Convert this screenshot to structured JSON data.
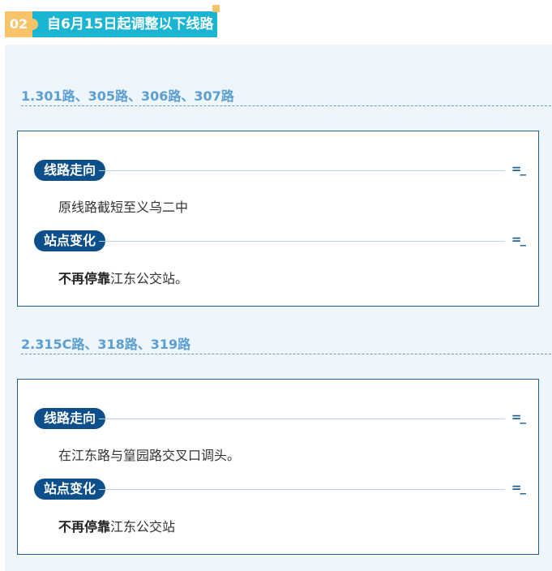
{
  "header": {
    "number": "02",
    "title": "自6月15日起调整以下线路"
  },
  "sections": [
    {
      "title": "1.301路、305路、306路、307路",
      "route_label": "线路走向",
      "route_text": "原线路截短至义乌二中",
      "stop_label": "站点变化",
      "stop_bold": "不再停靠",
      "stop_text": "江东公交站。",
      "marker": "=_"
    },
    {
      "title": "2.315C路、318路、319路",
      "route_label": "线路走向",
      "route_text": "在江东路与篁园路交叉口调头。",
      "stop_label": "站点变化",
      "stop_bold": "不再停靠",
      "stop_text": "江东公交站",
      "marker": "=_"
    }
  ]
}
